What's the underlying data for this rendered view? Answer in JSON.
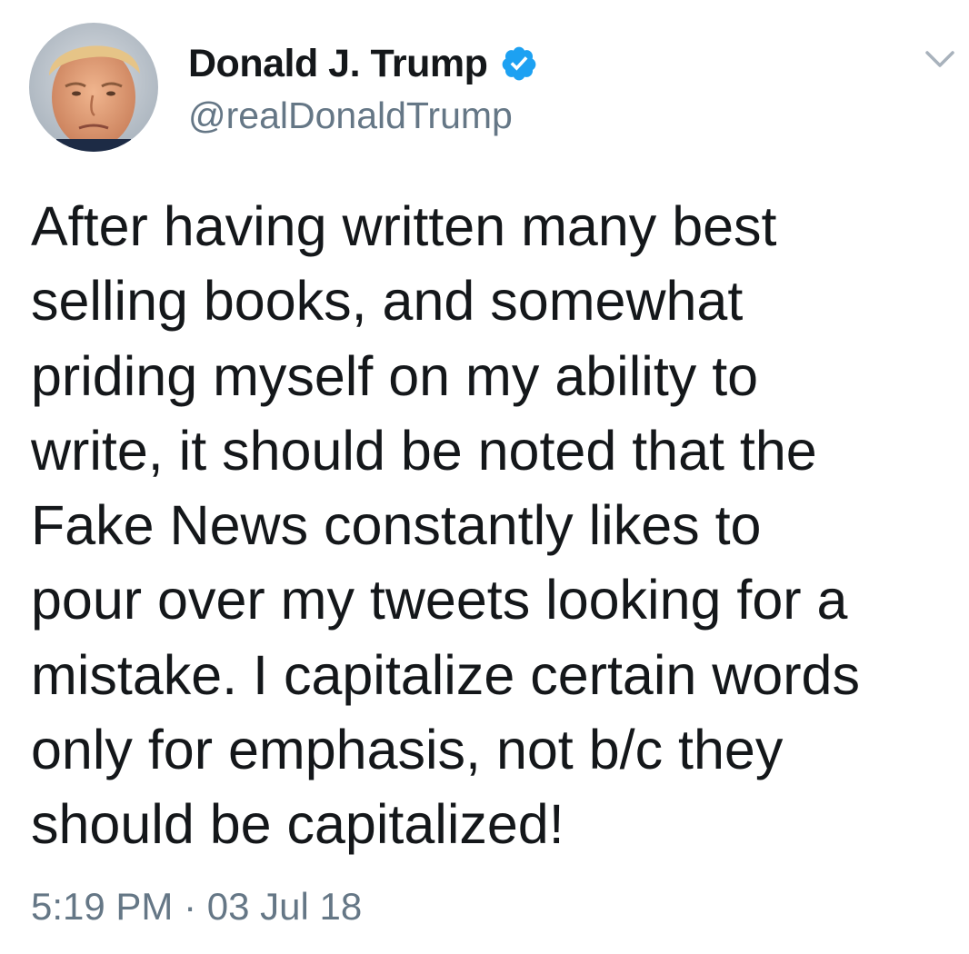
{
  "user": {
    "display_name": "Donald J. Trump",
    "handle": "@realDonaldTrump",
    "verified": true,
    "verified_color": "#1da1f2"
  },
  "icons": {
    "verified": "verified-badge-icon",
    "menu": "chevron-down-icon"
  },
  "tweet": {
    "text": "After having written many best\nselling books, and somewhat\npriding myself on my ability to\nwrite, it should be noted that the\nFake News constantly likes to\npour over my tweets looking for a\nmistake. I capitalize certain words\nonly for emphasis, not b/c they\nshould be capitalized!",
    "timestamp": "5:19 PM · 03 Jul 18"
  },
  "colors": {
    "text": "#14171a",
    "secondary": "#657786",
    "background": "#ffffff"
  }
}
